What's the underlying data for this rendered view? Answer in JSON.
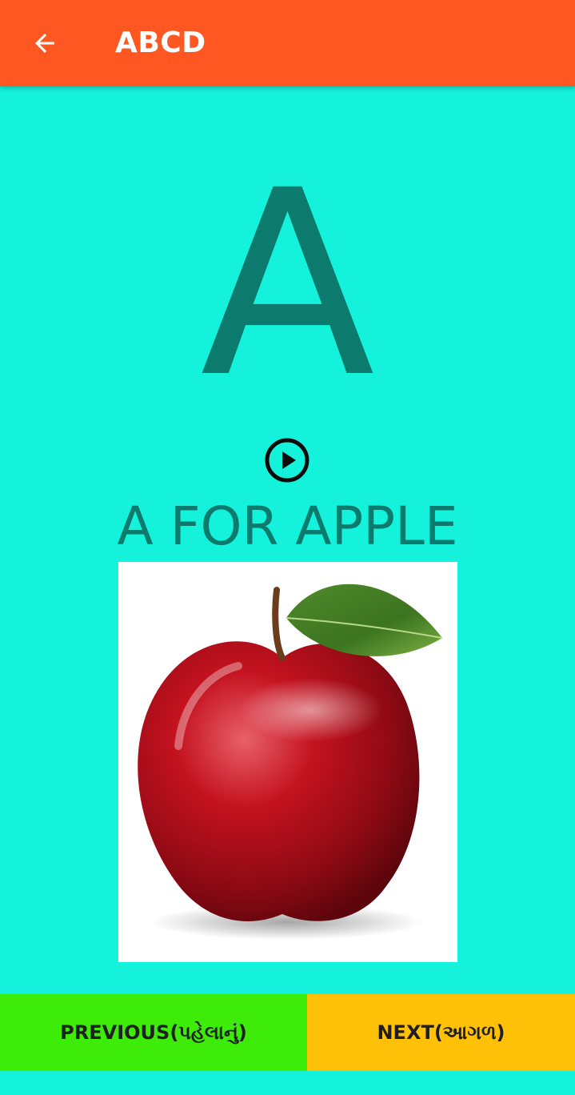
{
  "app_bar": {
    "title": "ABCD",
    "back_icon": "arrow-left-icon",
    "background_color": "#FF5722"
  },
  "lesson": {
    "letter": "A",
    "play_icon": "play-circle-icon",
    "word_label": "A FOR APPLE",
    "picture": "apple-image"
  },
  "navigation": {
    "previous_label": "PREVIOUS(પહેલાનું)",
    "next_label": "NEXT(આગળ)",
    "previous_color": "#3EEC0A",
    "next_color": "#FFC107"
  },
  "colors": {
    "background": "#14F2DB",
    "text_teal": "#0C7A6C"
  }
}
